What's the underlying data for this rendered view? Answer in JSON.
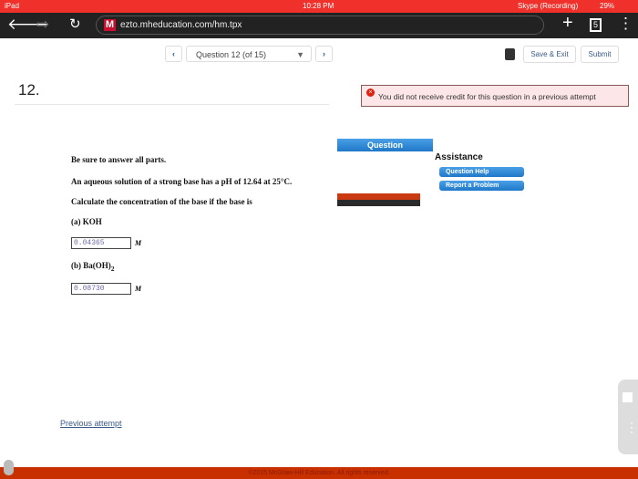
{
  "status_bar": {
    "device": "iPad",
    "time": "10:28 PM",
    "recording": "Skype (Recording)",
    "battery": "29%"
  },
  "browser": {
    "url": "ezto.mheducation.com/hm.tpx",
    "logo": "M",
    "tab_count": "5"
  },
  "toolbar": {
    "question_select": "Question 12 (of 15)",
    "save_exit": "Save & Exit",
    "submit": "Submit"
  },
  "question": {
    "number": "12.",
    "alert": "You did not receive credit for this question in a previous attempt",
    "instruction": "Be sure to answer all parts.",
    "prompt": "An aqueous solution of a strong base has a pH of 12.64 at 25°C.",
    "task": "Calculate the concentration of the base if the base is",
    "part_a": "(a) KOH",
    "answer_a": "0.04365",
    "part_b_prefix": "(b) Ba(OH)",
    "part_b_sub": "2",
    "answer_b": "0.08730",
    "unit": "M"
  },
  "side": {
    "question_tab": "Question",
    "assistance": "Assistance",
    "help": "Question Help",
    "report": "Report a Problem"
  },
  "links": {
    "previous_attempt": "Previous attempt"
  },
  "footer": {
    "copyright": "©2015 McGraw-Hill Education. All rights reserved."
  }
}
